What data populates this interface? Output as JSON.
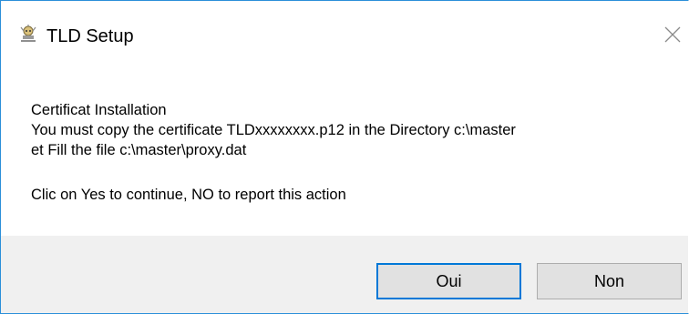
{
  "window": {
    "title": "TLD Setup",
    "app_icon": "installer-icon",
    "close_icon": "close-icon"
  },
  "message": {
    "lines": [
      "Certificat Installation",
      "You must copy the certificate TLDxxxxxxxx.p12 in the Directory c:\\master",
      "et Fill the file c:\\master\\proxy.dat",
      "Clic on Yes to continue, NO to report this action"
    ]
  },
  "buttons": {
    "yes_label": "Oui",
    "no_label": "Non"
  },
  "colors": {
    "border": "#2b8fd9",
    "footer_bg": "#f0f0f0",
    "button_bg": "#e1e1e1",
    "default_button_border": "#0078d7"
  }
}
